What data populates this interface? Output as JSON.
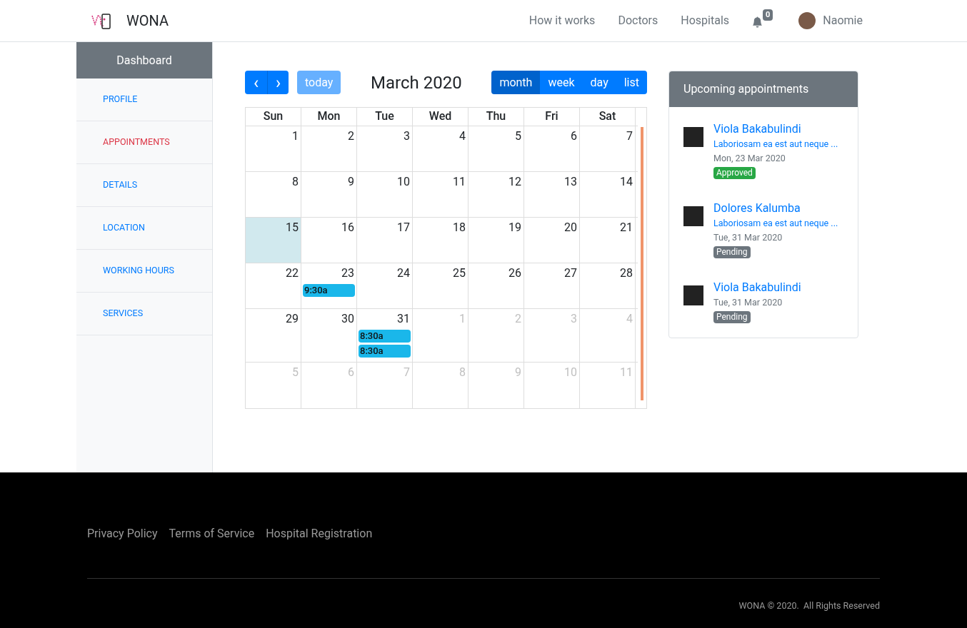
{
  "navbar": {
    "brand": "WONA",
    "links": [
      "How it works",
      "Doctors",
      "Hospitals"
    ],
    "notification_count": "0",
    "user": "Naomie"
  },
  "sidebar": {
    "title": "Dashboard",
    "items": [
      {
        "label": "PROFILE",
        "selected": false
      },
      {
        "label": "APPOINTMENTS",
        "selected": true
      },
      {
        "label": "DETAILS",
        "selected": false
      },
      {
        "label": "LOCATION",
        "selected": false
      },
      {
        "label": "WORKING HOURS",
        "selected": false
      },
      {
        "label": "SERVICES",
        "selected": false
      }
    ]
  },
  "calendar": {
    "title": "March 2020",
    "today_button": "today",
    "prev": "‹",
    "next": "›",
    "views": [
      {
        "label": "month",
        "selected": true
      },
      {
        "label": "week",
        "selected": false
      },
      {
        "label": "day",
        "selected": false
      },
      {
        "label": "list",
        "selected": false
      }
    ],
    "weekdays": [
      "Sun",
      "Mon",
      "Tue",
      "Wed",
      "Thu",
      "Fri",
      "Sat"
    ],
    "weeks": [
      [
        {
          "day": "1",
          "other_month": false,
          "today": false
        },
        {
          "day": "2",
          "other_month": false,
          "today": false
        },
        {
          "day": "3",
          "other_month": false,
          "today": false
        },
        {
          "day": "4",
          "other_month": false,
          "today": false
        },
        {
          "day": "5",
          "other_month": false,
          "today": false
        },
        {
          "day": "6",
          "other_month": false,
          "today": false
        },
        {
          "day": "7",
          "other_month": false,
          "today": false
        }
      ],
      [
        {
          "day": "8",
          "other_month": false,
          "today": false
        },
        {
          "day": "9",
          "other_month": false,
          "today": false
        },
        {
          "day": "10",
          "other_month": false,
          "today": false
        },
        {
          "day": "11",
          "other_month": false,
          "today": false
        },
        {
          "day": "12",
          "other_month": false,
          "today": false
        },
        {
          "day": "13",
          "other_month": false,
          "today": false
        },
        {
          "day": "14",
          "other_month": false,
          "today": false
        }
      ],
      [
        {
          "day": "15",
          "other_month": false,
          "today": true
        },
        {
          "day": "16",
          "other_month": false,
          "today": false
        },
        {
          "day": "17",
          "other_month": false,
          "today": false
        },
        {
          "day": "18",
          "other_month": false,
          "today": false
        },
        {
          "day": "19",
          "other_month": false,
          "today": false
        },
        {
          "day": "20",
          "other_month": false,
          "today": false
        },
        {
          "day": "21",
          "other_month": false,
          "today": false
        }
      ],
      [
        {
          "day": "22",
          "other_month": false,
          "today": false
        },
        {
          "day": "23",
          "other_month": false,
          "today": false,
          "events": [
            "9:30a"
          ]
        },
        {
          "day": "24",
          "other_month": false,
          "today": false
        },
        {
          "day": "25",
          "other_month": false,
          "today": false
        },
        {
          "day": "26",
          "other_month": false,
          "today": false
        },
        {
          "day": "27",
          "other_month": false,
          "today": false
        },
        {
          "day": "28",
          "other_month": false,
          "today": false
        }
      ],
      [
        {
          "day": "29",
          "other_month": false,
          "today": false
        },
        {
          "day": "30",
          "other_month": false,
          "today": false
        },
        {
          "day": "31",
          "other_month": false,
          "today": false,
          "events": [
            "8:30a",
            "8:30a"
          ]
        },
        {
          "day": "1",
          "other_month": true,
          "today": false
        },
        {
          "day": "2",
          "other_month": true,
          "today": false
        },
        {
          "day": "3",
          "other_month": true,
          "today": false
        },
        {
          "day": "4",
          "other_month": true,
          "today": false
        }
      ],
      [
        {
          "day": "5",
          "other_month": true,
          "today": false
        },
        {
          "day": "6",
          "other_month": true,
          "today": false
        },
        {
          "day": "7",
          "other_month": true,
          "today": false
        },
        {
          "day": "8",
          "other_month": true,
          "today": false
        },
        {
          "day": "9",
          "other_month": true,
          "today": false
        },
        {
          "day": "10",
          "other_month": true,
          "today": false
        },
        {
          "day": "11",
          "other_month": true,
          "today": false
        }
      ]
    ]
  },
  "appointments": {
    "title": "Upcoming appointments",
    "items": [
      {
        "name": "Viola Bakabulindi",
        "note": "Laboriosam ea est aut neque ...",
        "date": "Mon, 23 Mar 2020",
        "status": {
          "kind": "approved",
          "label": "Approved"
        }
      },
      {
        "name": "Dolores Kalumba",
        "note": "Laboriosam ea est aut neque ...",
        "date": "Tue, 31 Mar 2020",
        "status": {
          "kind": "pending",
          "label": "Pending"
        }
      },
      {
        "name": "Viola Bakabulindi",
        "date": "Tue, 31 Mar 2020",
        "status": {
          "kind": "pending",
          "label": "Pending"
        }
      }
    ]
  },
  "footer": {
    "links": [
      "Privacy Policy",
      "Terms of Service",
      "Hospital Registration"
    ],
    "copyright": "WONA © 2020.  All Rights Reserved"
  }
}
